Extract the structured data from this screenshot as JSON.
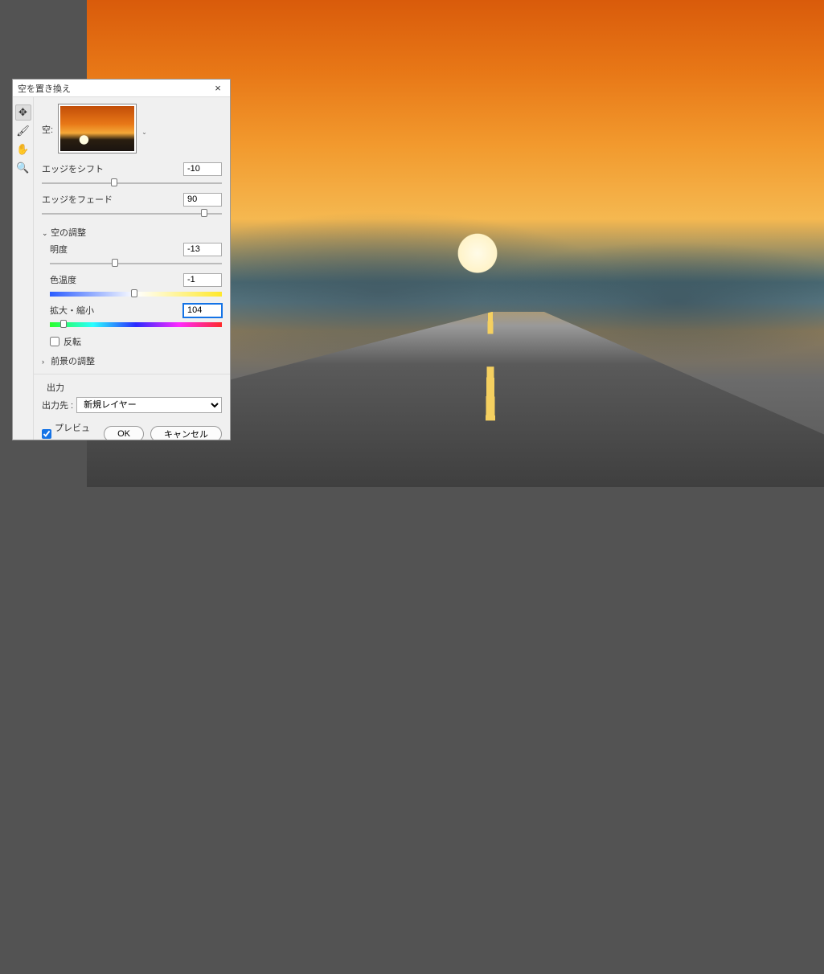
{
  "dialog": {
    "title": "空を置き換え",
    "close": "×"
  },
  "tools": {
    "move": "✥",
    "brush": "🖌",
    "hand": "✋",
    "zoom": "🔍"
  },
  "sky": {
    "label": "空:",
    "chevron": "⌄"
  },
  "edge_shift": {
    "label": "エッジをシフト",
    "value": "-10",
    "pos": 40
  },
  "edge_fade": {
    "label": "エッジをフェード",
    "value": "90",
    "pos": 90
  },
  "sky_adjust_header": "空の調整",
  "brightness": {
    "label": "明度",
    "value": "-13",
    "pos": 38
  },
  "temperature": {
    "label": "色温度",
    "value": "-1",
    "pos": 49
  },
  "scale": {
    "label": "拡大・縮小",
    "value": "104",
    "pos": 8
  },
  "flip": {
    "label": "反転",
    "checked": false
  },
  "fg_adjust_header": "前景の調整",
  "output": {
    "section": "出力",
    "label": "出力先 :",
    "value": "新規レイヤー"
  },
  "preview": {
    "label": "プレビュー",
    "checked": true
  },
  "buttons": {
    "ok": "OK",
    "cancel": "キャンセル"
  },
  "triangles": {
    "down": "⌄",
    "right": "›"
  }
}
